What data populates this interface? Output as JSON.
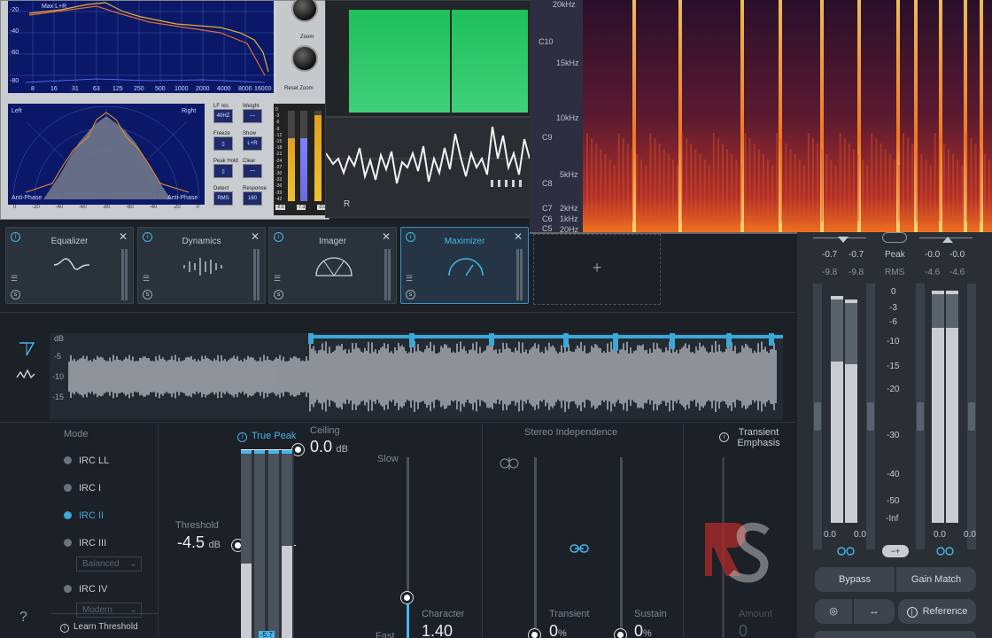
{
  "analyzer": {
    "legend": "Max L+R",
    "freq_ticks": [
      "8",
      "16",
      "31",
      "63",
      "125",
      "250",
      "500",
      "1000",
      "2000",
      "4000",
      "8000",
      "16000"
    ],
    "db_ticks": [
      "-20",
      "-40",
      "-60",
      "-80"
    ],
    "knob_zoom_label": "Zoom",
    "knob_reset_label": "Reset Zoom",
    "scope_left": "Left",
    "scope_right": "Right",
    "scope_anti_left": "Anti-Phase",
    "scope_anti_right": "Anti-Phase",
    "scope_axis": [
      "0",
      "-20",
      "-40",
      "-60",
      "-80",
      "-60",
      "-40",
      "-20",
      "0"
    ],
    "controls": [
      {
        "label": "LF res",
        "value": "40HZ"
      },
      {
        "label": "Weight",
        "value": "—"
      },
      {
        "label": "Freeze",
        "value": "▯"
      },
      {
        "label": "Show",
        "value": "L+R"
      },
      {
        "label": "Peak Hold",
        "value": "▯"
      },
      {
        "label": "Clear",
        "value": "—"
      },
      {
        "label": "Detect",
        "value": "RMS"
      },
      {
        "label": "Response",
        "value": "160"
      }
    ],
    "meter_scale": [
      "0",
      "-3",
      "-6",
      "-9",
      "-12",
      "-15",
      "-18",
      "-21",
      "-24",
      "-27",
      "-30",
      "-33",
      "-36",
      "-39",
      "-42"
    ],
    "meter_readout": [
      "-0.0",
      "-7.3",
      "-0.0"
    ]
  },
  "wave_panel": {
    "channel": "R"
  },
  "spectrogram": {
    "freq_labels": [
      "20kHz",
      "15kHz",
      "10kHz",
      "5kHz",
      "2kHz",
      "1kHz",
      "20Hz"
    ],
    "note_labels": [
      "C10",
      "C9",
      "C8",
      "C7",
      "C6",
      "C5"
    ]
  },
  "modules": [
    {
      "title": "Equalizer"
    },
    {
      "title": "Dynamics"
    },
    {
      "title": "Imager"
    },
    {
      "title": "Maximizer"
    }
  ],
  "add_module": "+",
  "waveform": {
    "db_labels": [
      "dB",
      "-5",
      "-10",
      "-15"
    ]
  },
  "mode": {
    "title": "Mode",
    "items": [
      "IRC LL",
      "IRC I",
      "IRC II",
      "IRC III",
      "IRC IV"
    ],
    "selected": "IRC II",
    "irc3_sub": "Balanced",
    "irc4_sub": "Modern",
    "learn": "Learn Threshold"
  },
  "maximizer": {
    "true_peak": "True Peak",
    "ceiling_label": "Ceiling",
    "ceiling_value": "0.0",
    "ceiling_unit": "dB",
    "threshold_label": "Threshold",
    "threshold_value": "-4.5",
    "threshold_unit": "dB",
    "meter_readout": "-5.7",
    "slow": "Slow",
    "fast": "Fast",
    "character_label": "Character",
    "character_value": "1.40",
    "stereo_title": "Stereo Independence",
    "transient_label": "Transient",
    "transient_value": "0",
    "sustain_label": "Sustain",
    "sustain_value": "0",
    "percent": "%",
    "transient_emphasis": "Transient Emphasis",
    "amount_label": "Amount",
    "amount_value": "0"
  },
  "meters": {
    "peak_label": "Peak",
    "rms_label": "RMS",
    "in_peak": [
      "-0.7",
      "-0.7"
    ],
    "in_rms": [
      "-9.8",
      "-9.8"
    ],
    "out_peak": [
      "-0.0",
      "-0.0"
    ],
    "out_rms": [
      "-4.6",
      "-4.6"
    ],
    "scale": [
      "0",
      "-3",
      "-6",
      "-10",
      "-15",
      "-20",
      "-30",
      "-40",
      "-50",
      "-Inf"
    ],
    "in_gain": [
      "0.0",
      "0.0"
    ],
    "out_gain": [
      "0.0",
      "0.0"
    ],
    "bypass": "Bypass",
    "gain_match": "Gain Match",
    "reference": "Reference"
  },
  "help": "?"
}
